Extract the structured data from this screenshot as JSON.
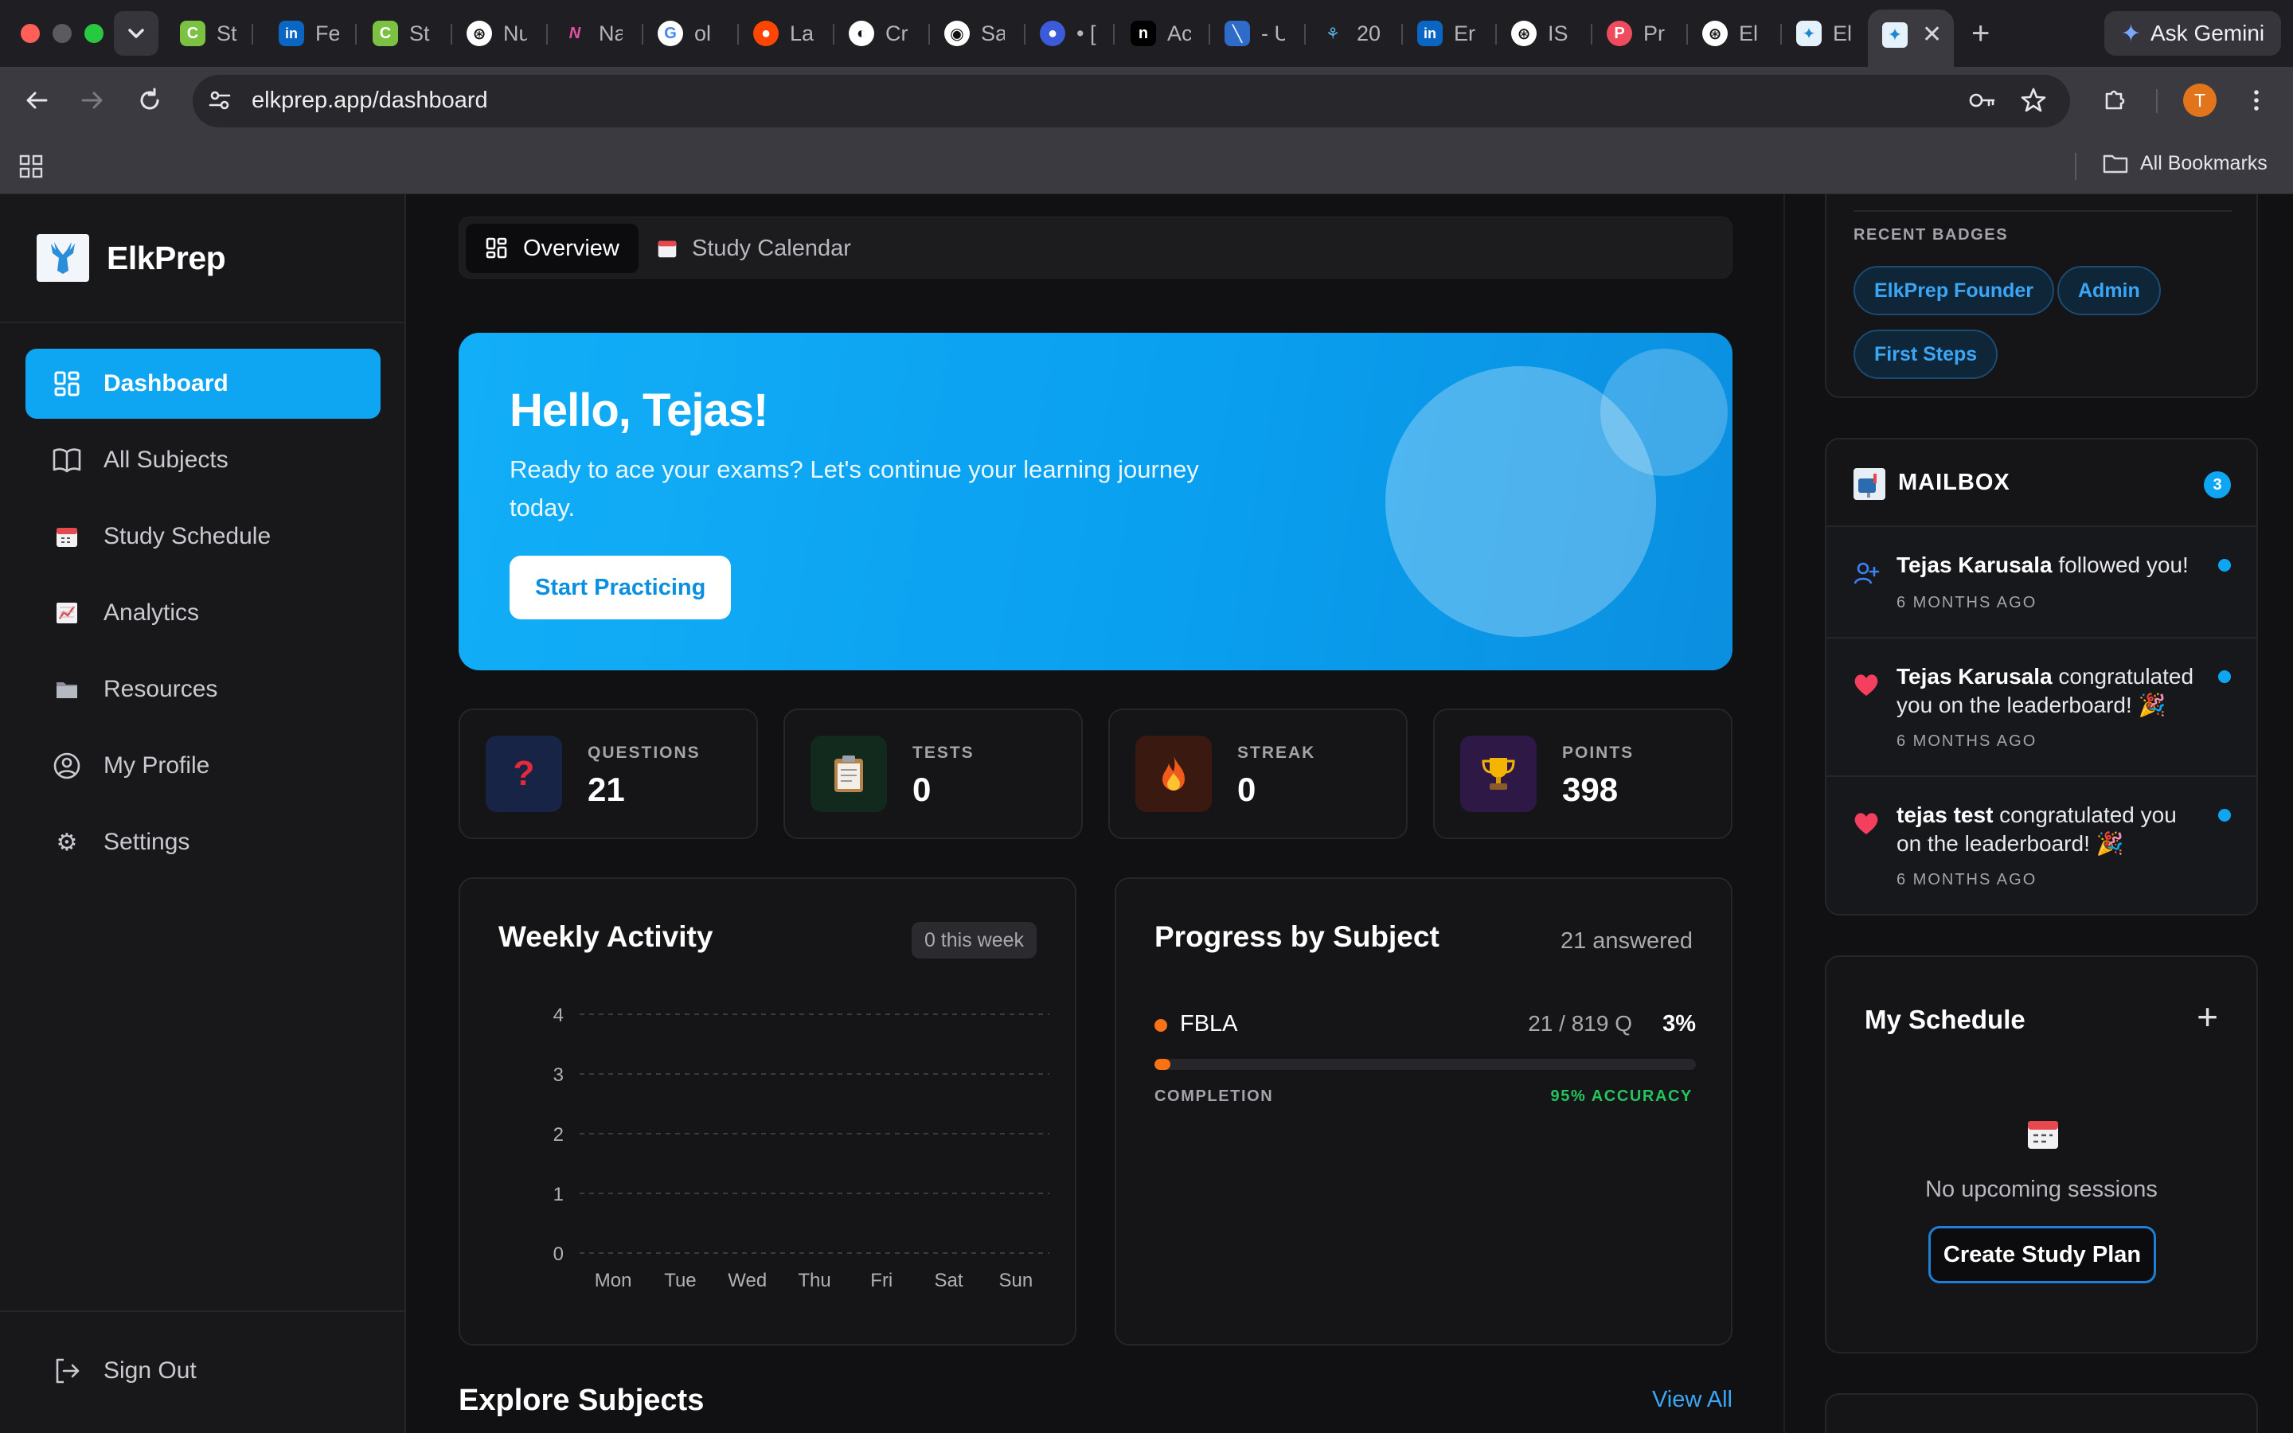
{
  "browser": {
    "tabs": [
      "St",
      "Fe",
      "St",
      "Nu",
      "Na",
      "ol",
      "La",
      "Cr",
      "Sa",
      "• [",
      "Ac",
      "- U",
      "20",
      "Er",
      "IS",
      "Pr",
      "El",
      "El"
    ],
    "ask_gemini": "Ask Gemini",
    "url_host": "elkprep.app",
    "url_path": "/dashboard",
    "profile_initial": "T",
    "all_bookmarks": "All Bookmarks"
  },
  "sidebar": {
    "brand": "ElkPrep",
    "items": [
      {
        "label": "Dashboard",
        "icon": "dashboard-icon",
        "active": true
      },
      {
        "label": "All Subjects",
        "icon": "book-icon"
      },
      {
        "label": "Study Schedule",
        "icon": "calendar-icon"
      },
      {
        "label": "Analytics",
        "icon": "chart-icon"
      },
      {
        "label": "Resources",
        "icon": "folder-icon"
      },
      {
        "label": "My Profile",
        "icon": "user-icon"
      },
      {
        "label": "Settings",
        "icon": "gear-icon"
      }
    ],
    "sign_out": "Sign Out"
  },
  "tabs": {
    "overview": "Overview",
    "calendar": "Study Calendar"
  },
  "hero": {
    "greeting": "Hello, Tejas!",
    "subtitle": "Ready to ace your exams? Let's continue your learning journey today.",
    "cta": "Start Practicing"
  },
  "stats": [
    {
      "label": "QUESTIONS",
      "value": "21",
      "icon": "question-icon"
    },
    {
      "label": "TESTS",
      "value": "0",
      "icon": "clipboard-icon"
    },
    {
      "label": "STREAK",
      "value": "0",
      "icon": "fire-icon"
    },
    {
      "label": "POINTS",
      "value": "398",
      "icon": "trophy-icon"
    }
  ],
  "weekly": {
    "title": "Weekly Activity",
    "pill": "0 this week"
  },
  "chart_data": {
    "type": "bar",
    "title": "Weekly Activity",
    "categories": [
      "Mon",
      "Tue",
      "Wed",
      "Thu",
      "Fri",
      "Sat",
      "Sun"
    ],
    "values": [
      0,
      0,
      0,
      0,
      0,
      0,
      0
    ],
    "yticks": [
      0,
      1,
      2,
      3,
      4
    ],
    "ylim": [
      0,
      4
    ],
    "grid": true
  },
  "progress": {
    "title": "Progress by Subject",
    "answered": "21 answered",
    "subjects": [
      {
        "name": "FBLA",
        "count": "21 / 819 Q",
        "percent": "3%",
        "fraction": 0.03,
        "completion_label": "COMPLETION",
        "accuracy": "95% ACCURACY",
        "color": "#f97316"
      }
    ]
  },
  "explore": {
    "title": "Explore Subjects",
    "view_all": "View All"
  },
  "badges": {
    "title": "RECENT BADGES",
    "items": [
      "ElkPrep Founder",
      "Admin",
      "First Steps"
    ]
  },
  "mailbox": {
    "title": "MAILBOX",
    "count": "3",
    "items": [
      {
        "name": "Tejas Karusala",
        "text": " followed you!",
        "time": "6 MONTHS AGO",
        "icon": "user-plus-icon"
      },
      {
        "name": "Tejas Karusala",
        "text": " congratulated you on the leaderboard! 🎉",
        "time": "6 MONTHS AGO",
        "icon": "heart-icon"
      },
      {
        "name": "tejas test",
        "text": " congratulated you on the leaderboard! 🎉",
        "time": "6 MONTHS AGO",
        "icon": "heart-icon"
      }
    ]
  },
  "schedule": {
    "title": "My Schedule",
    "empty": "No upcoming sessions",
    "cta": "Create Study Plan"
  },
  "colors": {
    "accent": "#0ea5f2",
    "orange": "#f97316",
    "green": "#22c55e",
    "heart": "#f43f5e"
  }
}
